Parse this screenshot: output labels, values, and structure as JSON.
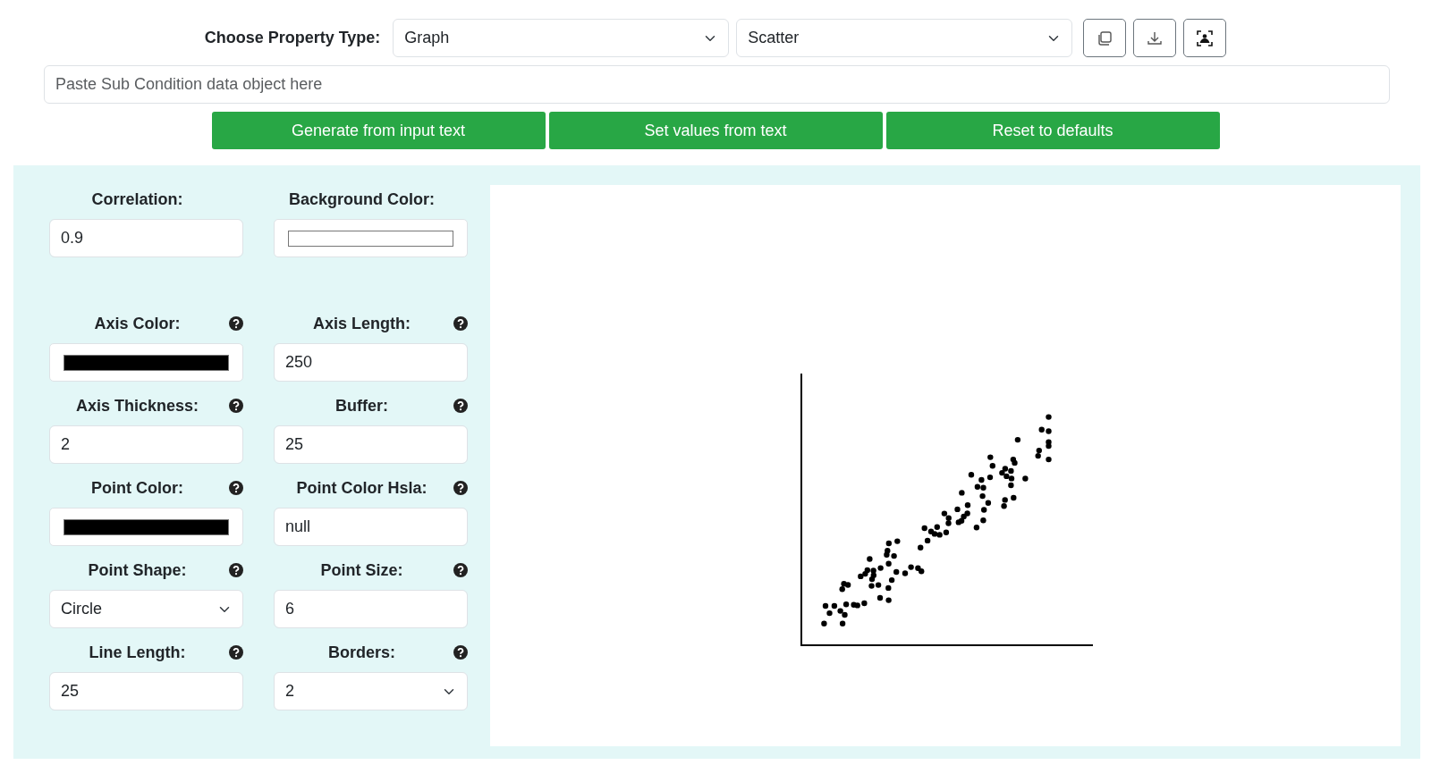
{
  "toolbar": {
    "label": "Choose Property Type:",
    "property_type": {
      "value": "Graph"
    },
    "graph_type": {
      "value": "Scatter"
    },
    "icon_buttons": [
      {
        "kind": "copy"
      },
      {
        "kind": "download"
      },
      {
        "kind": "screenshot"
      }
    ]
  },
  "data_input": {
    "placeholder": "Paste Sub Condition data object here"
  },
  "actions": [
    "Generate from input text",
    "Set values from text",
    "Reset to defaults"
  ],
  "fields": [
    {
      "label": "Correlation:",
      "kind": "text",
      "value": "0.9",
      "help": false
    },
    {
      "label": "Background Color:",
      "kind": "color",
      "color": "#ffffff",
      "help": false
    },
    {
      "label": "Axis Color:",
      "kind": "color",
      "color": "#000000",
      "help": true
    },
    {
      "label": "Axis Length:",
      "kind": "text",
      "value": "250",
      "help": true
    },
    {
      "label": "Axis Thickness:",
      "kind": "text",
      "value": "2",
      "help": true
    },
    {
      "label": "Buffer:",
      "kind": "text",
      "value": "25",
      "help": true
    },
    {
      "label": "Point Color:",
      "kind": "color",
      "color": "#000000",
      "help": true
    },
    {
      "label": "Point Color Hsla:",
      "kind": "text",
      "value": "null",
      "help": true
    },
    {
      "label": "Point Shape:",
      "kind": "select",
      "value": "Circle",
      "help": true
    },
    {
      "label": "Point Size:",
      "kind": "text",
      "value": "6",
      "help": true
    },
    {
      "label": "Line Length:",
      "kind": "text",
      "value": "25",
      "help": true
    },
    {
      "label": "Borders:",
      "kind": "select",
      "value": "2",
      "help": true
    }
  ]
}
